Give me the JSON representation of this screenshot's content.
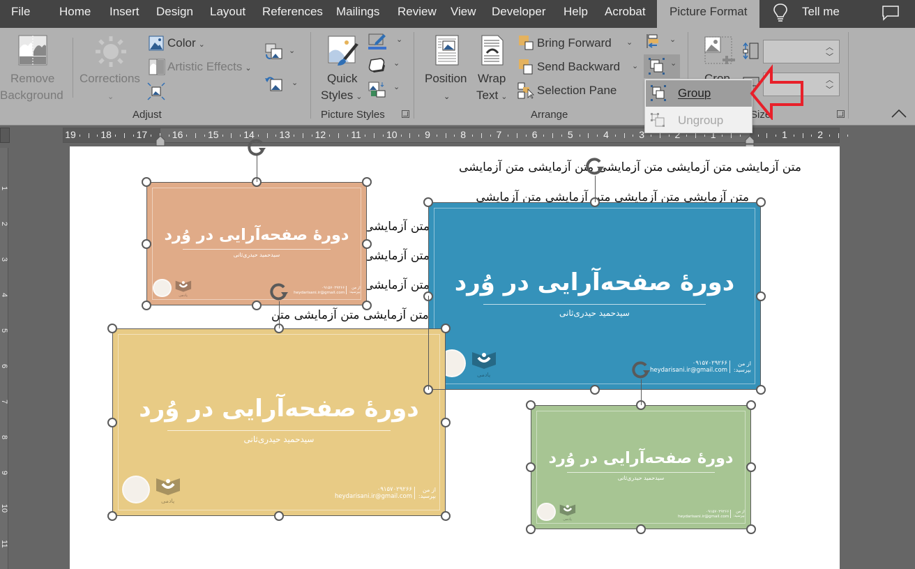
{
  "tabs": {
    "items": [
      "File",
      "Home",
      "Insert",
      "Design",
      "Layout",
      "References",
      "Mailings",
      "Review",
      "View",
      "Developer",
      "Help",
      "Acrobat"
    ],
    "active": "Picture Format",
    "tell_me": "Tell me"
  },
  "ribbon": {
    "adjust": {
      "remove_background_line1": "Remove",
      "remove_background_line2": "Background",
      "corrections": "Corrections",
      "color": "Color",
      "artistic_effects": "Artistic Effects",
      "group_label": "Adjust"
    },
    "picture_styles": {
      "quick_styles_line1": "Quick",
      "quick_styles_line2": "Styles",
      "group_label": "Picture Styles"
    },
    "arrange": {
      "position": "Position",
      "wrap_text_line1": "Wrap",
      "wrap_text_line2": "Text",
      "bring_forward": "Bring Forward",
      "send_backward": "Send Backward",
      "selection_pane": "Selection Pane",
      "group_label": "Arrange"
    },
    "size": {
      "crop": "Crop",
      "group_label": "Size",
      "height_value": "",
      "width_value": ""
    }
  },
  "group_menu": {
    "group": "Group",
    "ungroup": "Ungroup"
  },
  "ruler": {
    "horizontal": [
      "19",
      "18",
      "17",
      "16",
      "15",
      "14",
      "13",
      "12",
      "11",
      "10",
      "9",
      "8",
      "7",
      "6",
      "5",
      "4",
      "3",
      "2",
      "1",
      "",
      "1",
      "2"
    ],
    "vertical": [
      "1",
      "2",
      "3",
      "4",
      "5",
      "6",
      "7",
      "8",
      "9",
      "10",
      "11"
    ]
  },
  "document": {
    "lines": [
      "متن آزمایشی متن آزمایشی متن آزمایشی متن آزمایشی متن آزمایشی",
      "متن آزمایشی متن آزمایشی متن آزمایشی متن آزمایشی",
      "متن آزمایشی",
      "متن آزمایشی",
      "متن آزمایشی",
      "متن آزمایشی متن آزمایشی متن آزمایشی متن"
    ]
  },
  "cards": [
    {
      "id": "orange",
      "color": "#e0ab88",
      "title": "دورهٔ صفحه‌آرایی در وُرد",
      "subtitle": "سیدحمید حیدری‌ثانی",
      "phone": "۰۹۱۵۷۰۲۹۲۶۶",
      "email": "heydarisani.ir@gmail.com",
      "ask_line1": "از من",
      "ask_line2": "بپرسید:",
      "brand": "یادمی"
    },
    {
      "id": "blue",
      "color": "#3592ba",
      "title": "دورهٔ صفحه‌آرایی در وُرد",
      "subtitle": "سیدحمید حیدری‌ثانی",
      "phone": "۰۹۱۵۷۰۲۹۲۶۶",
      "email": "heydarisani.ir@gmail.com",
      "ask_line1": "از من",
      "ask_line2": "بپرسید:",
      "brand": "یادمی"
    },
    {
      "id": "yellow",
      "color": "#e8cb85",
      "title": "دورهٔ صفحه‌آرایی در وُرد",
      "subtitle": "سیدحمید حیدری‌ثانی",
      "phone": "۰۹۱۵۷۰۲۹۲۶۶",
      "email": "heydarisani.ir@gmail.com",
      "ask_line1": "از من",
      "ask_line2": "بپرسید:",
      "brand": "یادمی"
    },
    {
      "id": "green",
      "color": "#a7c593",
      "title": "دورهٔ صفحه‌آرایی در وُرد",
      "subtitle": "سیدحمید حیدری‌ثانی",
      "phone": "۰۹۱۵۷۰۲۹۲۶۶",
      "email": "heydarisani.ir@gmail.com",
      "ask_line1": "از من",
      "ask_line2": "بپرسید:",
      "brand": "یادمی"
    }
  ],
  "colors": {
    "annotation_arrow": "#e8202a",
    "tabbar_bg": "#444444",
    "ribbon_bg": "#b1b1b1"
  }
}
